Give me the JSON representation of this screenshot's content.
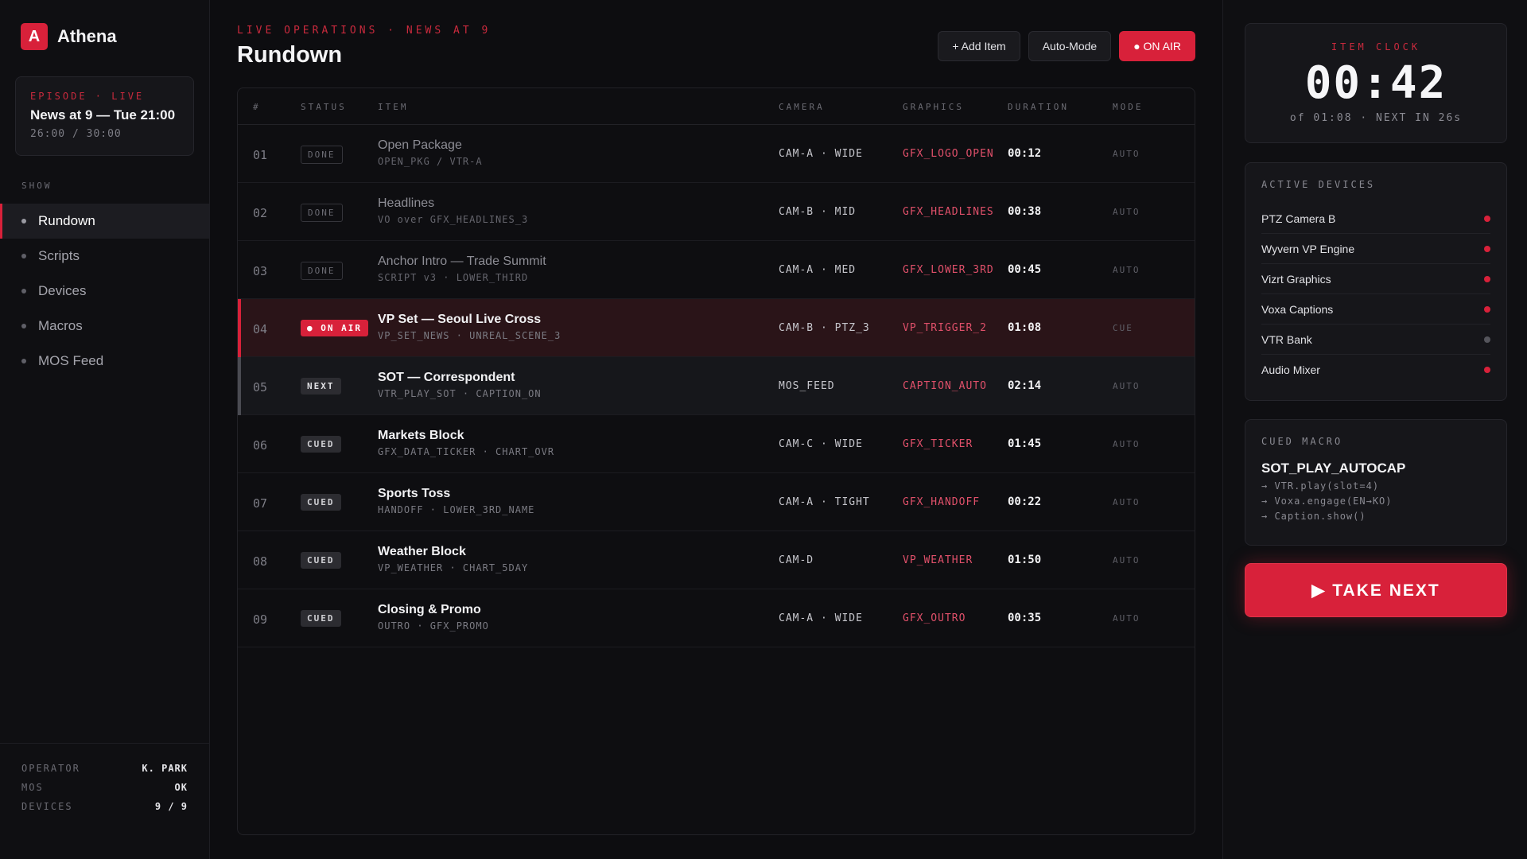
{
  "colors": {
    "accent": "#d8213a",
    "gfx": "#e0506a",
    "led_gray": "#55555c"
  },
  "brand": {
    "logo_letter": "A",
    "name": "Athena"
  },
  "episode": {
    "label": "EPISODE · LIVE",
    "title": "News at 9 — Tue 21:00",
    "time": "26:00 / 30:00"
  },
  "sidebar": {
    "section_label": "SHOW",
    "items": [
      {
        "label": "Rundown"
      },
      {
        "label": "Scripts"
      },
      {
        "label": "Devices"
      },
      {
        "label": "Macros"
      },
      {
        "label": "MOS Feed"
      }
    ],
    "footer": [
      {
        "key": "OPERATOR",
        "value": "K. PARK"
      },
      {
        "key": "MOS",
        "value": "OK"
      },
      {
        "key": "DEVICES",
        "value": "9 / 9"
      }
    ]
  },
  "header": {
    "eyebrow": "LIVE OPERATIONS · NEWS AT 9",
    "title": "Rundown",
    "add_item": "+ Add Item",
    "auto_mode": "Auto-Mode",
    "on_air": "● ON AIR"
  },
  "table": {
    "columns": [
      "#",
      "STATUS",
      "ITEM",
      "CAMERA",
      "GRAPHICS",
      "DURATION",
      "MODE"
    ],
    "rows": [
      {
        "num": "01",
        "status": "DONE",
        "state": "done",
        "title": "Open Package",
        "sub": "OPEN_PKG / VTR-A",
        "camera": "CAM-A · WIDE",
        "gfx": "GFX_LOGO_OPEN",
        "duration": "00:12",
        "mode": "AUTO"
      },
      {
        "num": "02",
        "status": "DONE",
        "state": "done",
        "title": "Headlines",
        "sub": "VO over GFX_HEADLINES_3",
        "camera": "CAM-B · MID",
        "gfx": "GFX_HEADLINES",
        "duration": "00:38",
        "mode": "AUTO"
      },
      {
        "num": "03",
        "status": "DONE",
        "state": "done",
        "title": "Anchor Intro — Trade Summit",
        "sub": "SCRIPT v3 · LOWER_THIRD",
        "camera": "CAM-A · MED",
        "gfx": "GFX_LOWER_3RD",
        "duration": "00:45",
        "mode": "AUTO"
      },
      {
        "num": "04",
        "status": "● ON AIR",
        "state": "onair",
        "title": "VP Set — Seoul Live Cross",
        "sub": "VP_SET_NEWS · UNREAL_SCENE_3",
        "camera": "CAM-B · PTZ_3",
        "gfx": "VP_TRIGGER_2",
        "duration": "01:08",
        "mode": "CUE"
      },
      {
        "num": "05",
        "status": "NEXT",
        "state": "next",
        "title": "SOT — Correspondent",
        "sub": "VTR_PLAY_SOT · CAPTION_ON",
        "camera": "MOS_FEED",
        "gfx": "CAPTION_AUTO",
        "duration": "02:14",
        "mode": "AUTO"
      },
      {
        "num": "06",
        "status": "CUED",
        "state": "cued",
        "title": "Markets Block",
        "sub": "GFX_DATA_TICKER · CHART_OVR",
        "camera": "CAM-C · WIDE",
        "gfx": "GFX_TICKER",
        "duration": "01:45",
        "mode": "AUTO"
      },
      {
        "num": "07",
        "status": "CUED",
        "state": "cued",
        "title": "Sports Toss",
        "sub": "HANDOFF · LOWER_3RD_NAME",
        "camera": "CAM-A · TIGHT",
        "gfx": "GFX_HANDOFF",
        "duration": "00:22",
        "mode": "AUTO"
      },
      {
        "num": "08",
        "status": "CUED",
        "state": "cued",
        "title": "Weather Block",
        "sub": "VP_WEATHER · CHART_5DAY",
        "camera": "CAM-D",
        "gfx": "VP_WEATHER",
        "duration": "01:50",
        "mode": "AUTO"
      },
      {
        "num": "09",
        "status": "CUED",
        "state": "cued",
        "title": "Closing & Promo",
        "sub": "OUTRO · GFX_PROMO",
        "camera": "CAM-A · WIDE",
        "gfx": "GFX_OUTRO",
        "duration": "00:35",
        "mode": "AUTO"
      }
    ]
  },
  "clock": {
    "label": "ITEM CLOCK",
    "value": "00:42",
    "sub": "of 01:08 · NEXT IN 26s"
  },
  "devices": {
    "label": "ACTIVE DEVICES",
    "items": [
      {
        "name": "PTZ Camera B",
        "status": "active"
      },
      {
        "name": "Wyvern VP Engine",
        "status": "active"
      },
      {
        "name": "Vizrt Graphics",
        "status": "active"
      },
      {
        "name": "Voxa Captions",
        "status": "active"
      },
      {
        "name": "VTR Bank",
        "status": "idle"
      },
      {
        "name": "Audio Mixer",
        "status": "active"
      }
    ]
  },
  "macro": {
    "label": "CUED MACRO",
    "name": "SOT_PLAY_AUTOCAP",
    "lines": [
      "→ VTR.play(slot=4)",
      "→ Voxa.engage(EN→KO)",
      "→ Caption.show()"
    ]
  },
  "take_next": "▶ TAKE NEXT"
}
